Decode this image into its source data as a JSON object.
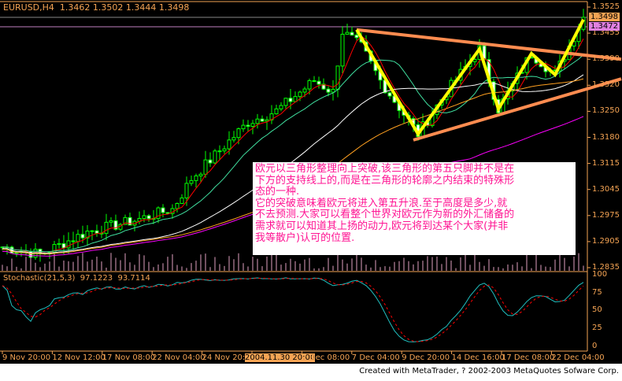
{
  "header": {
    "symbol": "EURUSD,H4",
    "ohlc": "1.3462 1.3502 1.3444 1.3498"
  },
  "indicator": {
    "name": "Stochastic(21,5,3)",
    "k": "97.1223",
    "d": "93.7114",
    "levels": [
      "100",
      "75",
      "50",
      "25",
      "0"
    ]
  },
  "price_axis": [
    "1.3525",
    "1.3455",
    "1.3390",
    "1.3320",
    "1.3250",
    "1.3180",
    "1.3115",
    "1.3045",
    "1.2975",
    "1.2905",
    "1.2835"
  ],
  "price_tags": {
    "bid": "1.3498",
    "ask": "1.3472"
  },
  "time_axis": [
    "9 Nov 20:00",
    "12 Nov 12:00",
    "17 Nov 08:00",
    "22 Nov 04:00",
    "24 Nov 20:00",
    "2004.11.30 20:00",
    "2 Dec 08:00",
    "7 Dec 04:00",
    "9 Dec 20:00",
    "14 Dec 16:00",
    "17 Dec 08:00",
    "22 Dec 04:00"
  ],
  "annotation": {
    "lines": [
      "欧元以三角形整理向上突破,该三角形的第五只脚并不是在",
      "下方的支持线上的,而是在三角形的轮廓之内结束的特殊形",
      "态的一种.",
      "它的突破意味着欧元将进入第五升浪.至于高度是多少,就",
      "不去预测.大家可以看整个世界对欧元作为新的外汇储备的",
      "需求就可以知道其上扬的动力,欧元将到达某个大家(并非",
      "我等散户)认可的位置."
    ]
  },
  "footer": "Created with MetaTrader, ? 2002-2003 MetaQuotes Sofware Corp.",
  "colors": {
    "bull": "#00ff00",
    "text": "#f5a454",
    "annot": "#ff1493",
    "zigzag": "#ffff00",
    "trend": "#ff8c50"
  },
  "chart_data": {
    "type": "candlestick",
    "title": "EURUSD,H4",
    "ylim": [
      1.2835,
      1.3525
    ],
    "bars": 124,
    "price_path": [
      [
        0,
        1.289
      ],
      [
        8,
        1.287
      ],
      [
        18,
        1.293
      ],
      [
        28,
        1.296
      ],
      [
        36,
        1.299
      ],
      [
        40,
        1.307
      ],
      [
        48,
        1.317
      ],
      [
        52,
        1.322
      ],
      [
        58,
        1.325
      ],
      [
        66,
        1.333
      ],
      [
        70,
        1.33
      ],
      [
        72,
        1.346
      ],
      [
        76,
        1.342
      ],
      [
        80,
        1.333
      ],
      [
        88,
        1.3189
      ],
      [
        94,
        1.33
      ],
      [
        101,
        1.3414
      ],
      [
        105,
        1.3255
      ],
      [
        112,
        1.3402
      ],
      [
        117,
        1.3346
      ],
      [
        123,
        1.3498
      ]
    ],
    "zigzag": [
      [
        75,
        1.3465
      ],
      [
        88,
        1.3189
      ],
      [
        101,
        1.3414
      ],
      [
        105,
        1.3255
      ],
      [
        112,
        1.3402
      ],
      [
        117,
        1.3346
      ],
      [
        123,
        1.3492
      ]
    ],
    "trendlines": [
      [
        [
          75,
          1.3465
        ],
        [
          131,
          1.3387
        ]
      ],
      [
        [
          87,
          1.3173
        ],
        [
          131,
          1.3335
        ]
      ]
    ],
    "ma_periods": [
      5,
      13,
      34,
      55,
      100
    ],
    "stoch_ylim": [
      0,
      100
    ]
  }
}
